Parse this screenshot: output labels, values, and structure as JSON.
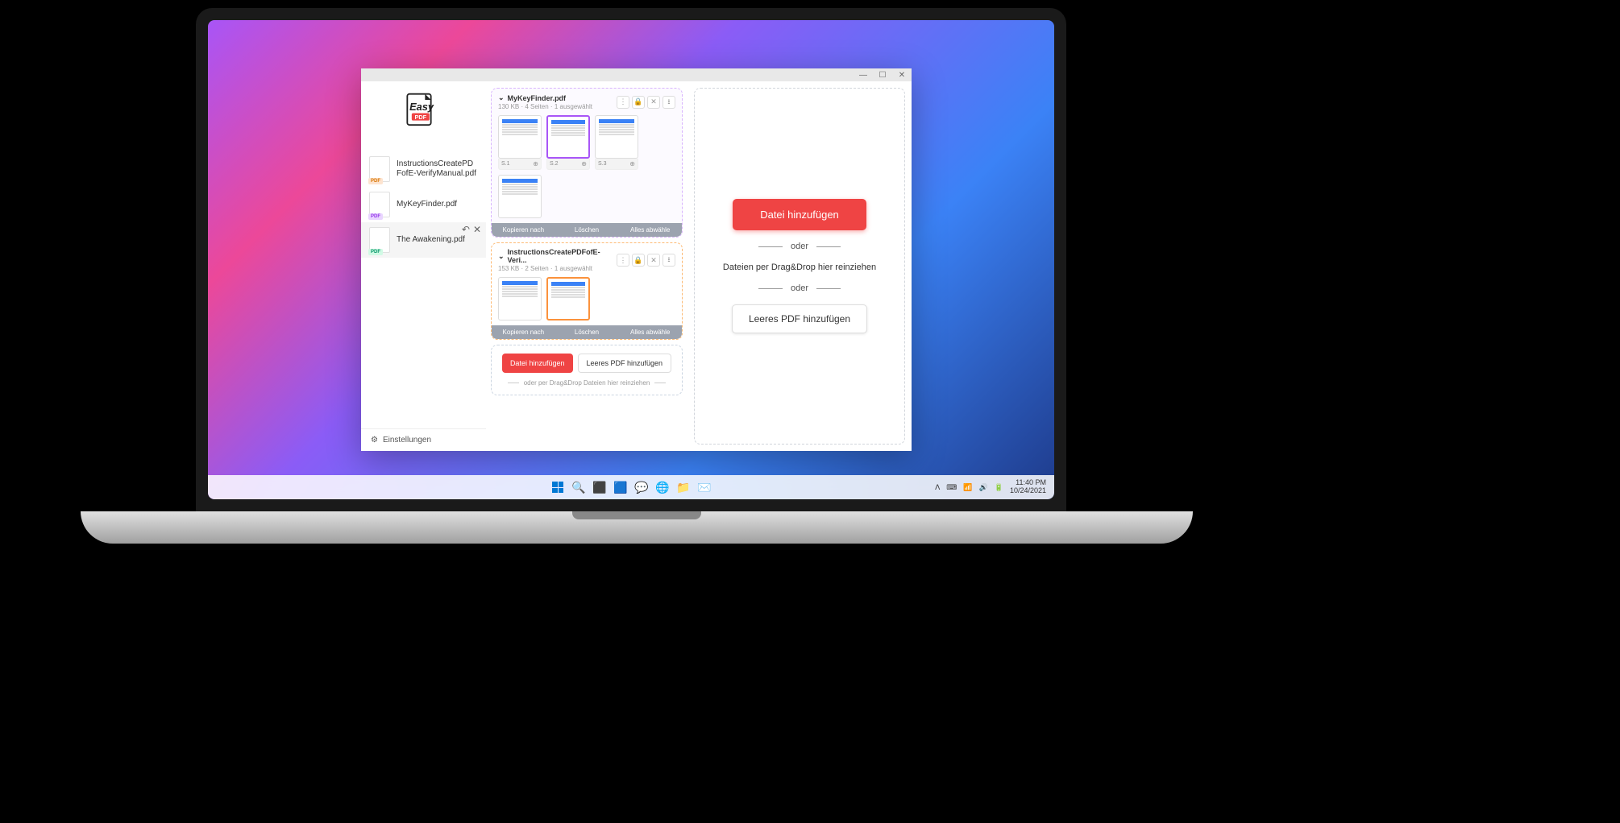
{
  "app": {
    "name": "Easy PDF"
  },
  "titlebar": {
    "minimize": "—",
    "maximize": "☐",
    "close": "✕"
  },
  "sidebar": {
    "files": [
      {
        "name": "InstructionsCreatePDFofE-VerifyManual.pdf",
        "badge": "PDF",
        "badgeClass": "badge-orange"
      },
      {
        "name": "MyKeyFinder.pdf",
        "badge": "PDF",
        "badgeClass": "badge-purple"
      },
      {
        "name": "The Awakening.pdf",
        "badge": "PDF",
        "badgeClass": "badge-green",
        "active": true
      }
    ],
    "settings": "Einstellungen"
  },
  "center": {
    "docs": [
      {
        "title": "MyKeyFinder.pdf",
        "meta": "130 KB  ·  4 Seiten  ·  1 ausgewählt",
        "cardClass": "lightpurple",
        "pages": [
          {
            "label": "S.1"
          },
          {
            "label": "S.2",
            "selected": true,
            "selClass": "purple"
          },
          {
            "label": "S.3"
          },
          {
            "label": ""
          }
        ],
        "actions": {
          "copy": "Kopieren nach",
          "delete": "Löschen",
          "deselect": "Alles abwähle"
        }
      },
      {
        "title": "InstructionsCreatePDFofE-Veri...",
        "meta": "153 KB  ·  2 Seiten  ·  1 ausgewählt",
        "cardClass": "orange",
        "pages": [
          {
            "label": ""
          },
          {
            "label": "",
            "selected": true,
            "selClass": ""
          }
        ],
        "actions": {
          "copy": "Kopieren nach",
          "delete": "Löschen",
          "deselect": "Alles abwähle"
        }
      }
    ],
    "add": {
      "addFile": "Datei hinzufügen",
      "addEmpty": "Leeres PDF hinzufügen",
      "dragText": "oder per Drag&Drop Dateien hier reinziehen"
    }
  },
  "right": {
    "addFile": "Datei hinzufügen",
    "or": "oder",
    "dragText": "Dateien per Drag&Drop hier reinziehen",
    "addEmpty": "Leeres PDF hinzufügen"
  },
  "taskbar": {
    "time": "11:40 PM",
    "date": "10/24/2021"
  }
}
